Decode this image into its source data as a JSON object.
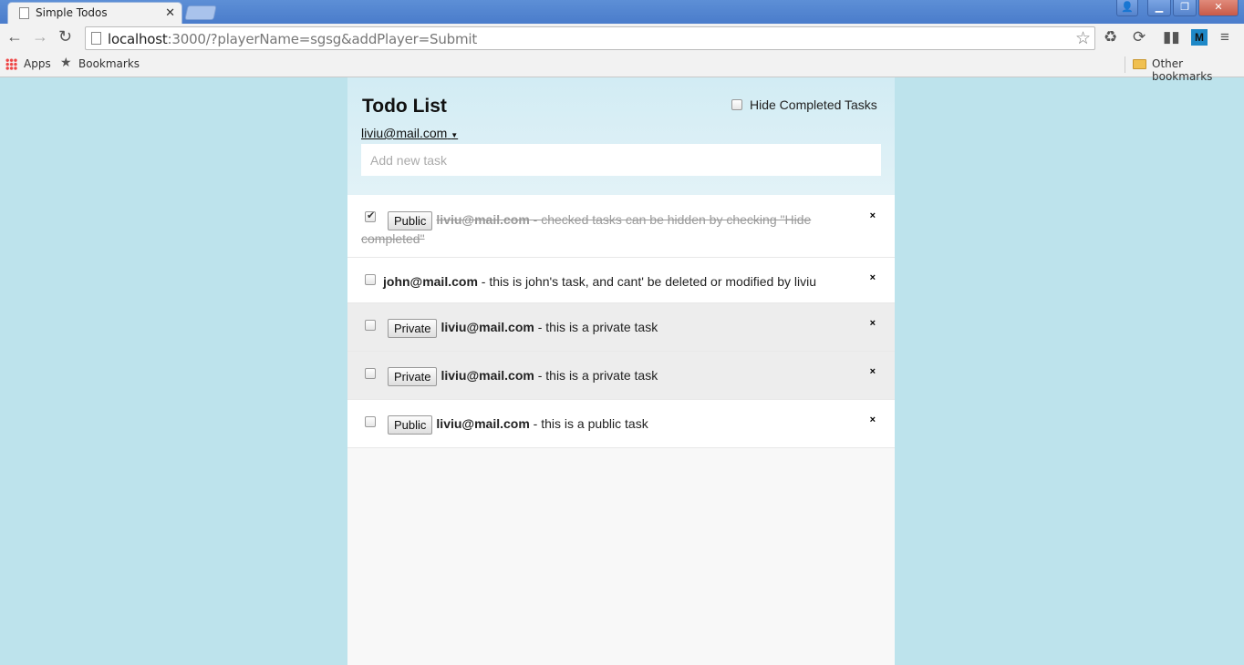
{
  "browser": {
    "tab_title": "Simple Todos",
    "url_host": "localhost",
    "url_rest": ":3000/?playerName=sgsg&addPlayer=Submit",
    "bookmarks": {
      "apps": "Apps",
      "bookmarks": "Bookmarks",
      "other": "Other bookmarks"
    },
    "ext_m": "M"
  },
  "app": {
    "title": "Todo List",
    "hide_completed_label": "Hide Completed Tasks",
    "hide_completed_checked": false,
    "user": "liviu@mail.com",
    "new_task_placeholder": "Add new task"
  },
  "tasks": [
    {
      "checked": true,
      "visibility_button": "Public",
      "owner": "liviu@mail.com",
      "text": " - checked tasks can be hidden by checking \"Hide completed\"",
      "private": false
    },
    {
      "checked": false,
      "visibility_button": "",
      "owner": "john@mail.com",
      "text": " - this is john's task, and cant' be deleted or modified by liviu",
      "private": false
    },
    {
      "checked": false,
      "visibility_button": "Private",
      "owner": "liviu@mail.com",
      "text": " - this is a private task",
      "private": true
    },
    {
      "checked": false,
      "visibility_button": "Private",
      "owner": "liviu@mail.com",
      "text": " - this is a private task",
      "private": true
    },
    {
      "checked": false,
      "visibility_button": "Public",
      "owner": "liviu@mail.com",
      "text": " - this is a public task",
      "private": false
    }
  ],
  "delete_glyph": "×"
}
